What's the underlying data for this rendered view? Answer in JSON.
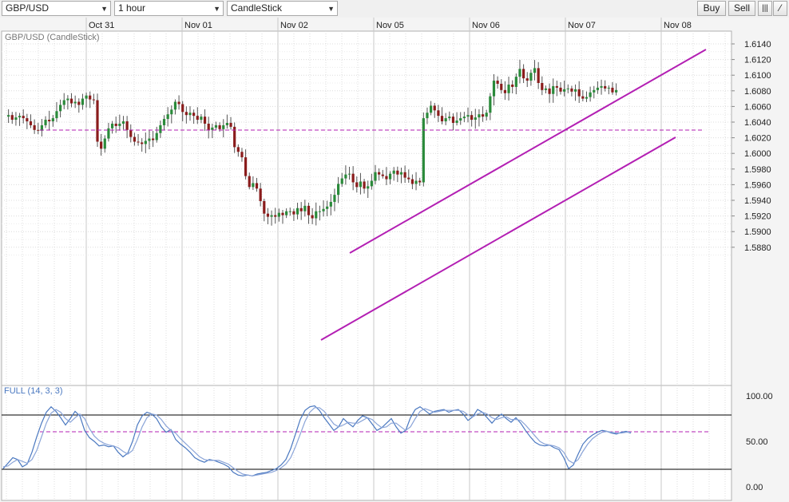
{
  "toolbar": {
    "symbol": "GBP/USD",
    "timeframe": "1 hour",
    "chart_type": "CandleStick",
    "buy_label": "Buy",
    "sell_label": "Sell",
    "dropdown_icon": "chevron-down-icon",
    "extra_icons": [
      "bar-style-icon",
      "draw-line-icon"
    ]
  },
  "colors": {
    "up": "#2a8a3a",
    "down": "#8a1c1c",
    "channel": "#b31fb3",
    "level": "#b31fb3",
    "stoch_k": "#4a78c0",
    "stoch_d": "#8aa4d8",
    "grid": "#dcdcdc",
    "panel_bg": "#ffffff"
  },
  "chart_data": [
    {
      "type": "candlestick",
      "title": "GBP/USD (CandleStick)",
      "x_labels": [
        "Oct 31",
        "Nov 01",
        "Nov 02",
        "Nov 05",
        "Nov 06",
        "Nov 07",
        "Nov 08"
      ],
      "ylim": [
        1.587,
        1.6155
      ],
      "y_ticks": [
        "1.6140",
        "1.6120",
        "1.6100",
        "1.6080",
        "1.6060",
        "1.6040",
        "1.6020",
        "1.6000",
        "1.5980",
        "1.5960",
        "1.5940",
        "1.5920",
        "1.5900",
        "1.5880"
      ],
      "grid": true,
      "close_path": [
        1.6047,
        1.6049,
        1.6043,
        1.6046,
        1.6048,
        1.6045,
        1.6041,
        1.6036,
        1.603,
        1.6029,
        1.6036,
        1.6043,
        1.6041,
        1.6045,
        1.6054,
        1.6062,
        1.6068,
        1.607,
        1.6064,
        1.6066,
        1.6062,
        1.607,
        1.6074,
        1.6069,
        1.6068,
        1.6015,
        1.6006,
        1.6019,
        1.6032,
        1.6038,
        1.6035,
        1.6038,
        1.6041,
        1.603,
        1.6021,
        1.6015,
        1.6014,
        1.6012,
        1.6016,
        1.6019,
        1.6017,
        1.6026,
        1.6036,
        1.6044,
        1.605,
        1.6056,
        1.6066,
        1.6063,
        1.6053,
        1.6049,
        1.6052,
        1.6048,
        1.6043,
        1.6047,
        1.6038,
        1.603,
        1.6033,
        1.6036,
        1.6031,
        1.6036,
        1.6039,
        1.6034,
        1.6008,
        1.6002,
        1.5995,
        1.5971,
        1.5957,
        1.5962,
        1.5955,
        1.5939,
        1.5923,
        1.5919,
        1.5921,
        1.5919,
        1.5924,
        1.5921,
        1.5926,
        1.5926,
        1.5922,
        1.593,
        1.5926,
        1.5933,
        1.5921,
        1.5917,
        1.5926,
        1.5926,
        1.5929,
        1.5932,
        1.5938,
        1.5947,
        1.5961,
        1.5968,
        1.5973,
        1.5974,
        1.5963,
        1.5957,
        1.5964,
        1.5955,
        1.5958,
        1.5965,
        1.5976,
        1.5973,
        1.5971,
        1.5967,
        1.5974,
        1.5978,
        1.5973,
        1.5976,
        1.5969,
        1.5967,
        1.5961,
        1.5965,
        1.5963,
        1.6045,
        1.6052,
        1.6061,
        1.6055,
        1.6048,
        1.6041,
        1.6045,
        1.6047,
        1.6039,
        1.6042,
        1.6045,
        1.6047,
        1.6049,
        1.6043,
        1.6046,
        1.605,
        1.6047,
        1.6052,
        1.6073,
        1.6093,
        1.6089,
        1.6081,
        1.6077,
        1.6088,
        1.6085,
        1.6098,
        1.6108,
        1.6096,
        1.6093,
        1.6103,
        1.6109,
        1.609,
        1.6081,
        1.6083,
        1.6076,
        1.6086,
        1.6084,
        1.6079,
        1.6082,
        1.6083,
        1.6079,
        1.6082,
        1.6073,
        1.607,
        1.6072,
        1.6078,
        1.6081,
        1.6084,
        1.6086,
        1.6083,
        1.6084,
        1.6078,
        1.6081
      ]
    },
    {
      "type": "line",
      "title": "FULL (14, 3, 3)",
      "ylim": [
        0,
        100
      ],
      "y_ticks": [
        "100.00",
        "50.00",
        "0.00"
      ],
      "levels": [
        80,
        20,
        60
      ],
      "series": [
        {
          "values": [
            20,
            26,
            32,
            30,
            22,
            25,
            38,
            55,
            70,
            82,
            88,
            83,
            76,
            68,
            75,
            83,
            78,
            62,
            54,
            50,
            45,
            46,
            44,
            45,
            38,
            33,
            37,
            50,
            68,
            78,
            82,
            80,
            75,
            66,
            60,
            63,
            52,
            47,
            43,
            38,
            32,
            29,
            27,
            30,
            29,
            27,
            25,
            22,
            16,
            13,
            12,
            13,
            12,
            14,
            15,
            16,
            18,
            20,
            24,
            30,
            42,
            58,
            74,
            84,
            88,
            89,
            84,
            76,
            69,
            62,
            66,
            75,
            70,
            66,
            73,
            78,
            76,
            69,
            62,
            65,
            70,
            75,
            66,
            59,
            62,
            76,
            85,
            88,
            84,
            80,
            83,
            84,
            85,
            82,
            84,
            85,
            80,
            73,
            77,
            85,
            82,
            76,
            70,
            76,
            80,
            75,
            71,
            76,
            70,
            62,
            55,
            49,
            46,
            45,
            46,
            43,
            41,
            32,
            20,
            24,
            36,
            47,
            53,
            57,
            60,
            62,
            61,
            59,
            58,
            60,
            61,
            59
          ]
        },
        {
          "values": [
            22,
            23,
            27,
            30,
            28,
            26,
            30,
            40,
            55,
            70,
            81,
            85,
            82,
            75,
            71,
            76,
            80,
            75,
            64,
            56,
            51,
            48,
            46,
            45,
            43,
            39,
            36,
            40,
            52,
            66,
            76,
            80,
            79,
            74,
            67,
            62,
            59,
            53,
            48,
            43,
            38,
            33,
            30,
            29,
            29,
            29,
            27,
            25,
            21,
            17,
            14,
            13,
            12,
            13,
            14,
            15,
            16,
            18,
            21,
            25,
            32,
            44,
            58,
            72,
            82,
            87,
            87,
            83,
            76,
            69,
            66,
            68,
            71,
            70,
            70,
            73,
            76,
            74,
            69,
            65,
            66,
            70,
            70,
            66,
            62,
            66,
            75,
            83,
            86,
            84,
            82,
            83,
            84,
            84,
            84,
            84,
            83,
            79,
            77,
            80,
            82,
            80,
            76,
            74,
            76,
            77,
            74,
            74,
            73,
            68,
            62,
            56,
            50,
            47,
            46,
            45,
            43,
            38,
            29,
            26,
            30,
            39,
            47,
            53,
            57,
            60,
            61,
            60,
            59,
            59,
            60,
            60
          ]
        }
      ]
    }
  ]
}
